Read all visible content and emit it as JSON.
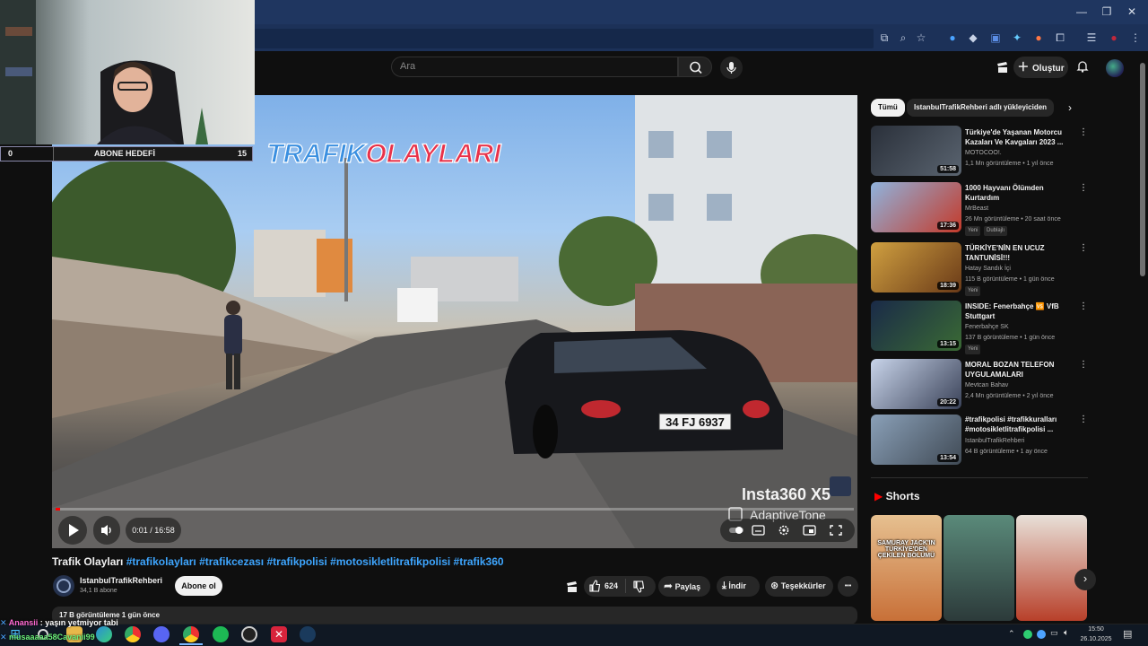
{
  "browser": {
    "controls": {
      "minimize": "—",
      "restore": "❐",
      "close": "✕"
    },
    "toolbar_icons": [
      "cast-icon",
      "zoom-icon",
      "bookmark-star-icon",
      "extension-icon",
      "extension-icon",
      "extension-icon",
      "extension-icon",
      "extension-icon",
      "extensions-puzzle-icon",
      "reading-list-icon",
      "profile-icon",
      "menu-icon"
    ]
  },
  "youtube": {
    "search_placeholder": "Ara",
    "create_label": "Oluştur",
    "video": {
      "overlay_title_a": "TRAFIK",
      "overlay_title_b": "OLAYLARI",
      "plate": "34 FJ 6937",
      "watermark_brand": "Insta360 X5",
      "watermark_tone": "AdaptiveTone",
      "time_text": "0:01 / 16:58",
      "progress": 0.001,
      "title_plain": "Trafik Olayları ",
      "title_tags": "#trafikolayları #trafikcezası #trafikpolisi #motosikletlitrafikpolisi #trafik360",
      "channel_name": "IstanbulTrafikRehberi",
      "channel_subs": "34,1 B abone",
      "subscribe_label": "Abone ol",
      "like_count": "624",
      "share_label": "Paylaş",
      "download_label": "İndir",
      "thanks_label": "Teşekkürler",
      "more_label": "•••",
      "description_meta": "17 B görüntüleme  1 gün önce"
    },
    "chips": [
      "Tümü",
      "IstanbulTrafikRehberi adlı yükleyiciden"
    ],
    "recommendations": [
      {
        "title": "Türkiye'de Yaşanan Motorcu Kazaları Ve Kavgaları 2023 ...",
        "channel": "MOTOCOO!.",
        "meta": "1,1 Mn görüntüleme  •  1 yıl önce",
        "duration": "51:58",
        "badges": [],
        "thumb_color": "#4a5460"
      },
      {
        "title": "1000 Hayvanı Ölümden Kurtardım",
        "channel": "MrBeast",
        "meta": "26 Mn görüntüleme  •  20 saat önce",
        "duration": "17:36",
        "badges": [
          "Yeni",
          "Dublajlı"
        ],
        "thumb_color": "#7aa0c8"
      },
      {
        "title": "TÜRKİYE'NİN EN UCUZ TANTUNİSİ!!!",
        "channel": "Hatay Sandık İçi",
        "meta": "115 B görüntüleme  •  1 gün önce",
        "duration": "18:39",
        "badges": [
          "Yeni"
        ],
        "thumb_color": "#b87a30"
      },
      {
        "title": "INSIDE: Fenerbahçe 🆚 VfB Stuttgart",
        "channel": "Fenerbahçe SK",
        "meta": "137 B görüntüleme  •  1 gün önce",
        "duration": "13:15",
        "badges": [
          "Yeni"
        ],
        "thumb_color": "#24406a"
      },
      {
        "title": "MORAL BOZAN TELEFON UYGULAMALARI",
        "channel": "Mevtcan Bahav",
        "meta": "2,4 Mn görüntüleme  •  2 yıl önce",
        "duration": "20:22",
        "badges": [],
        "thumb_color": "#5a6a88"
      },
      {
        "title": "#trafikpolisi #trafikkuralları #motosikletlitrafikpolisi ...",
        "channel": "IstanbulTrafikRehberi",
        "meta": "64 B görüntüleme  •  1 ay önce",
        "duration": "13:54",
        "badges": [],
        "thumb_color": "#6c7a88"
      }
    ],
    "shorts_label": "Shorts",
    "shorts_text": "SAMURAY JACK'IN TÜRKİYE'DEN ÇEKİLEN BÖLÜMÜ"
  },
  "stream": {
    "goal_start": "0",
    "goal_label": "ABONE HEDEFİ",
    "goal_end": "15",
    "chat": [
      {
        "user": "Anansii",
        "message": "yaşın yetmiyor tabi"
      },
      {
        "user": "musaaaaa58Cavanii99",
        "message": ""
      }
    ]
  },
  "taskbar": {
    "time": "15:50",
    "date": "26.10.2025",
    "apps": [
      "windows-start-icon",
      "search-icon",
      "file-explorer-icon",
      "edge-icon",
      "chrome-icon",
      "discord-icon",
      "chrome-icon",
      "spotify-icon",
      "obs-icon",
      "x-app-icon",
      "steam-icon"
    ]
  },
  "colors": {
    "accent_red": "#ff0000",
    "link_blue": "#3ea6ff",
    "browser_frame": "#1f3660"
  }
}
